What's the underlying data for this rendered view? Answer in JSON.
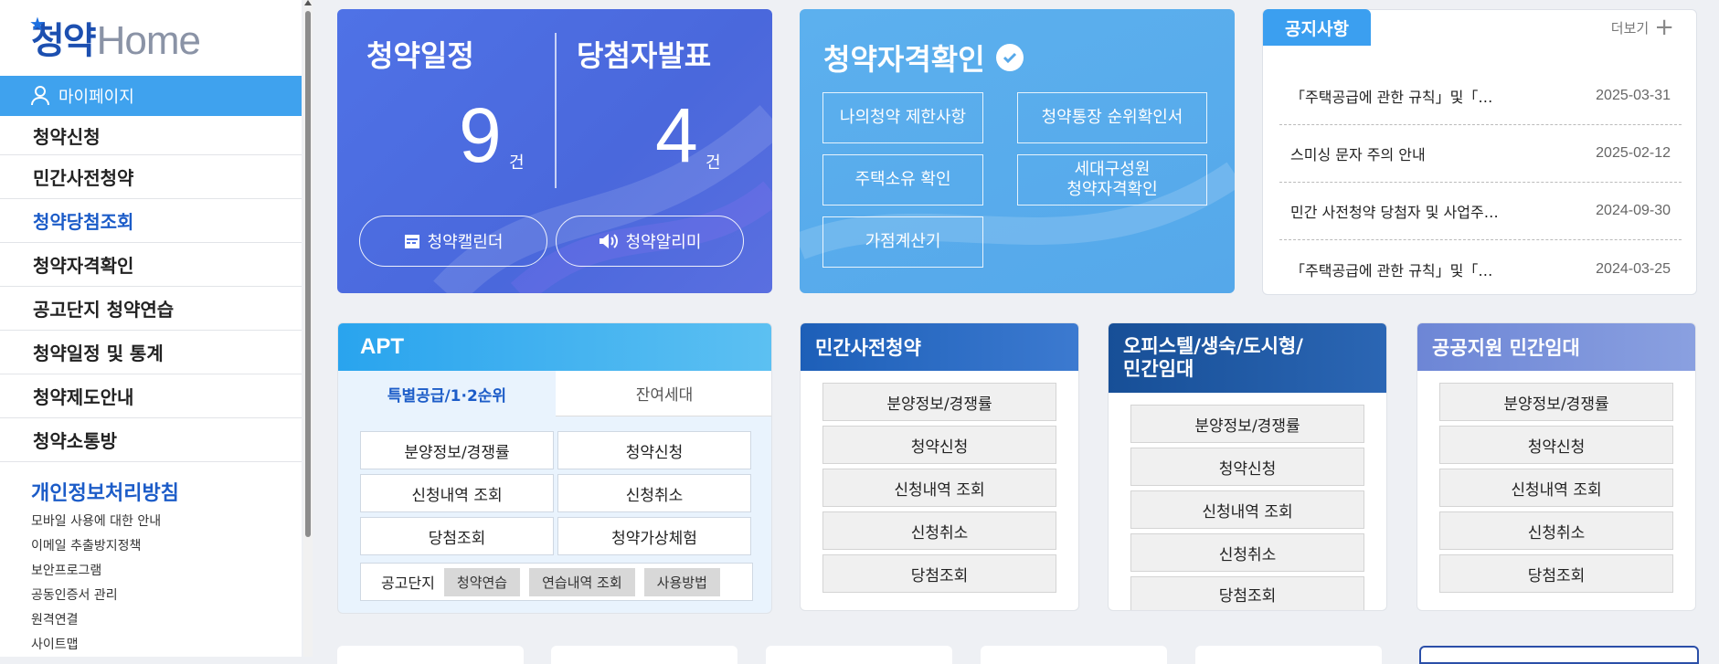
{
  "sidebar": {
    "logo": {
      "korean": "청약",
      "english": "Home"
    },
    "mypage": "마이페이지",
    "menu": [
      "청약신청",
      "민간사전청약",
      "청약당첨조회",
      "청약자격확인",
      "공고단지 청약연습",
      "청약일정 및 통계",
      "청약제도안내",
      "청약소통방"
    ],
    "active_menu": "청약당첨조회",
    "privacy": "개인정보처리방침",
    "sublinks": [
      "모바일 사용에 대한 안내",
      "이메일 추출방지정책",
      "보안프로그램",
      "공동인증서 관리",
      "원격연결",
      "사이트맵"
    ]
  },
  "schedule": {
    "left_label": "청약일정",
    "left_count": "9",
    "right_label": "당첨자발표",
    "right_count": "4",
    "unit": "건",
    "calendar_btn": "청약캘린더",
    "alarm_btn": "청약알리미",
    "colors": {
      "bg": "#4f72e6"
    }
  },
  "qualification": {
    "title": "청약자격확인",
    "buttons": [
      "나의청약 제한사항",
      "청약통장 순위확인서",
      "주택소유 확인",
      "세대구성원\n청약자격확인",
      "가점계산기"
    ],
    "colors": {
      "bg": "#5cb0ee"
    }
  },
  "notice": {
    "tab": "공지사항",
    "more": "더보기",
    "items": [
      {
        "title": "「주택공급에 관한 규칙」및「…",
        "date": "2025-03-31"
      },
      {
        "title": "스미싱 문자 주의 안내",
        "date": "2025-02-12"
      },
      {
        "title": "민간 사전청약 당첨자 및 사업주…",
        "date": "2024-09-30"
      },
      {
        "title": "「주택공급에 관한 규칙」및「…",
        "date": "2024-03-25"
      }
    ]
  },
  "apt": {
    "title": "APT",
    "tabs": [
      "특별공급/1·2순위",
      "잔여세대"
    ],
    "buttons": [
      "분양정보/경쟁률",
      "청약신청",
      "신청내역 조회",
      "신청취소",
      "당첨조회",
      "청약가상체험"
    ],
    "gongo_label": "공고단지",
    "gongo_chips": [
      "청약연습",
      "연습내역 조회",
      "사용방법"
    ]
  },
  "private_pre": {
    "title": "민간사전청약",
    "buttons": [
      "분양정보/경쟁률",
      "청약신청",
      "신청내역 조회",
      "신청취소",
      "당첨조회"
    ],
    "color": "#1d5fb8"
  },
  "officetel": {
    "title": "오피스텔/생숙/도시형/\n민간임대",
    "buttons": [
      "분양정보/경쟁률",
      "청약신청",
      "신청내역 조회",
      "신청취소",
      "당첨조회"
    ],
    "color": "#174f97"
  },
  "public_rental": {
    "title": "공공지원 민간임대",
    "buttons": [
      "분양정보/경쟁률",
      "청약신청",
      "신청내역 조회",
      "신청취소",
      "당첨조회"
    ],
    "color": "#6d86d6"
  }
}
